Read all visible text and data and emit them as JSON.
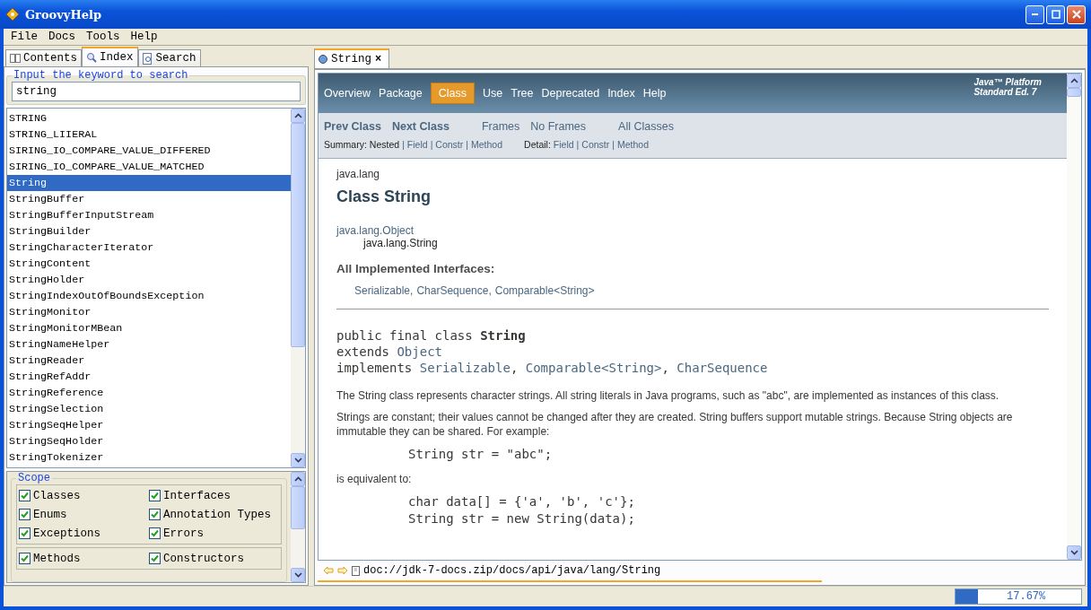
{
  "window": {
    "title": "GroovyHelp"
  },
  "menu": [
    "File",
    "Docs",
    "Tools",
    "Help"
  ],
  "side_tabs": [
    {
      "label": "Contents",
      "selected": false
    },
    {
      "label": "Index",
      "selected": true
    },
    {
      "label": "Search",
      "selected": false
    }
  ],
  "search": {
    "legend": "Input the keyword to search",
    "value": "string"
  },
  "index_list": [
    {
      "label": "STRING",
      "selected": false
    },
    {
      "label": "STRING_LIIERAL",
      "selected": false
    },
    {
      "label": "SIRING_IO_COMPARE_VALUE_DIFFERED",
      "selected": false
    },
    {
      "label": "SIRING_IO_COMPARE_VALUE_MATCHED",
      "selected": false
    },
    {
      "label": "String",
      "selected": true
    },
    {
      "label": "StringBuffer",
      "selected": false
    },
    {
      "label": "StringBufferInputStream",
      "selected": false
    },
    {
      "label": "StringBuilder",
      "selected": false
    },
    {
      "label": "StringCharacterIterator",
      "selected": false
    },
    {
      "label": "StringContent",
      "selected": false
    },
    {
      "label": "StringHolder",
      "selected": false
    },
    {
      "label": "StringIndexOutOfBoundsException",
      "selected": false
    },
    {
      "label": "StringMonitor",
      "selected": false
    },
    {
      "label": "StringMonitorMBean",
      "selected": false
    },
    {
      "label": "StringNameHelper",
      "selected": false
    },
    {
      "label": "StringReader",
      "selected": false
    },
    {
      "label": "StringRefAddr",
      "selected": false
    },
    {
      "label": "StringReference",
      "selected": false
    },
    {
      "label": "StringSelection",
      "selected": false
    },
    {
      "label": "StringSeqHelper",
      "selected": false
    },
    {
      "label": "StringSeqHolder",
      "selected": false
    },
    {
      "label": "StringTokenizer",
      "selected": false
    }
  ],
  "scope": {
    "legend": "Scope",
    "groups": [
      [
        {
          "label": "Classes",
          "checked": true
        },
        {
          "label": "Interfaces",
          "checked": true
        },
        {
          "label": "Enums",
          "checked": true
        },
        {
          "label": "Annotation Types",
          "checked": true
        },
        {
          "label": "Exceptions",
          "checked": true
        },
        {
          "label": "Errors",
          "checked": true
        }
      ],
      [
        {
          "label": "Methods",
          "checked": true
        },
        {
          "label": "Constructors",
          "checked": true
        }
      ]
    ]
  },
  "doc_tab": {
    "label": "String",
    "close": "×"
  },
  "doc": {
    "nav": [
      {
        "label": "Overview",
        "selected": false
      },
      {
        "label": "Package",
        "selected": false
      },
      {
        "label": "Class",
        "selected": true
      },
      {
        "label": "Use",
        "selected": false
      },
      {
        "label": "Tree",
        "selected": false
      },
      {
        "label": "Deprecated",
        "selected": false
      },
      {
        "label": "Index",
        "selected": false
      },
      {
        "label": "Help",
        "selected": false
      }
    ],
    "platform": [
      "Java™ Platform",
      "Standard Ed. 7"
    ],
    "subnav": [
      {
        "label": "Prev Class",
        "kind": "bold"
      },
      {
        "label": "Next Class",
        "kind": "bold"
      },
      {
        "label": "Frames",
        "kind": "plain"
      },
      {
        "label": "No Frames",
        "kind": "plain"
      },
      {
        "label": "All Classes",
        "kind": "plain"
      }
    ],
    "summary": [
      {
        "kind": "label",
        "text": "Summary:"
      },
      {
        "kind": "plain",
        "text": "Nested"
      },
      {
        "kind": "sep",
        "text": "|"
      },
      {
        "kind": "link",
        "text": "Field"
      },
      {
        "kind": "sep",
        "text": "|"
      },
      {
        "kind": "link",
        "text": "Constr"
      },
      {
        "kind": "sep",
        "text": "|"
      },
      {
        "kind": "link",
        "text": "Method"
      }
    ],
    "detail": [
      {
        "kind": "label",
        "text": "Detail:"
      },
      {
        "kind": "link",
        "text": "Field"
      },
      {
        "kind": "sep",
        "text": "|"
      },
      {
        "kind": "link",
        "text": "Constr"
      },
      {
        "kind": "sep",
        "text": "|"
      },
      {
        "kind": "link",
        "text": "Method"
      }
    ],
    "package": "java.lang",
    "title": "Class String",
    "inheritance": [
      "java.lang.Object",
      "java.lang.String"
    ],
    "interfaces_heading": "All Implemented Interfaces:",
    "interfaces": [
      "Serializable,",
      "CharSequence,",
      "Comparable<String>"
    ],
    "declaration": [
      [
        {
          "text": "public final class ",
          "kind": "text"
        },
        {
          "text": "String",
          "kind": "bold"
        }
      ],
      [
        {
          "text": "extends ",
          "kind": "text"
        },
        {
          "text": "Object",
          "kind": "link"
        }
      ],
      [
        {
          "text": "implements ",
          "kind": "text"
        },
        {
          "text": "Serializable",
          "kind": "link"
        },
        {
          "text": ", ",
          "kind": "text"
        },
        {
          "text": "Comparable<String>",
          "kind": "link"
        },
        {
          "text": ", ",
          "kind": "text"
        },
        {
          "text": "CharSequence",
          "kind": "link"
        }
      ]
    ],
    "body": [
      {
        "kind": "text",
        "lines": [
          "The String class represents character strings. All string literals in Java programs, such as \"abc\", are implemented as instances of this class."
        ]
      },
      {
        "kind": "text",
        "lines": [
          "Strings are constant; their values cannot be changed after they are created. String buffers support mutable strings. Because String objects are immutable they can be shared. For example:"
        ]
      },
      {
        "kind": "code",
        "lines": [
          "String str = \"abc\";"
        ]
      },
      {
        "kind": "text",
        "lines": [
          "is equivalent to:"
        ]
      },
      {
        "kind": "code",
        "lines": [
          "char data[] = {'a', 'b', 'c'};",
          "String str = new String(data);"
        ]
      }
    ]
  },
  "address": "doc://jdk-7-docs.zip/docs/api/java/lang/String",
  "status": {
    "level": 0.1767,
    "reading": "17.67%"
  }
}
